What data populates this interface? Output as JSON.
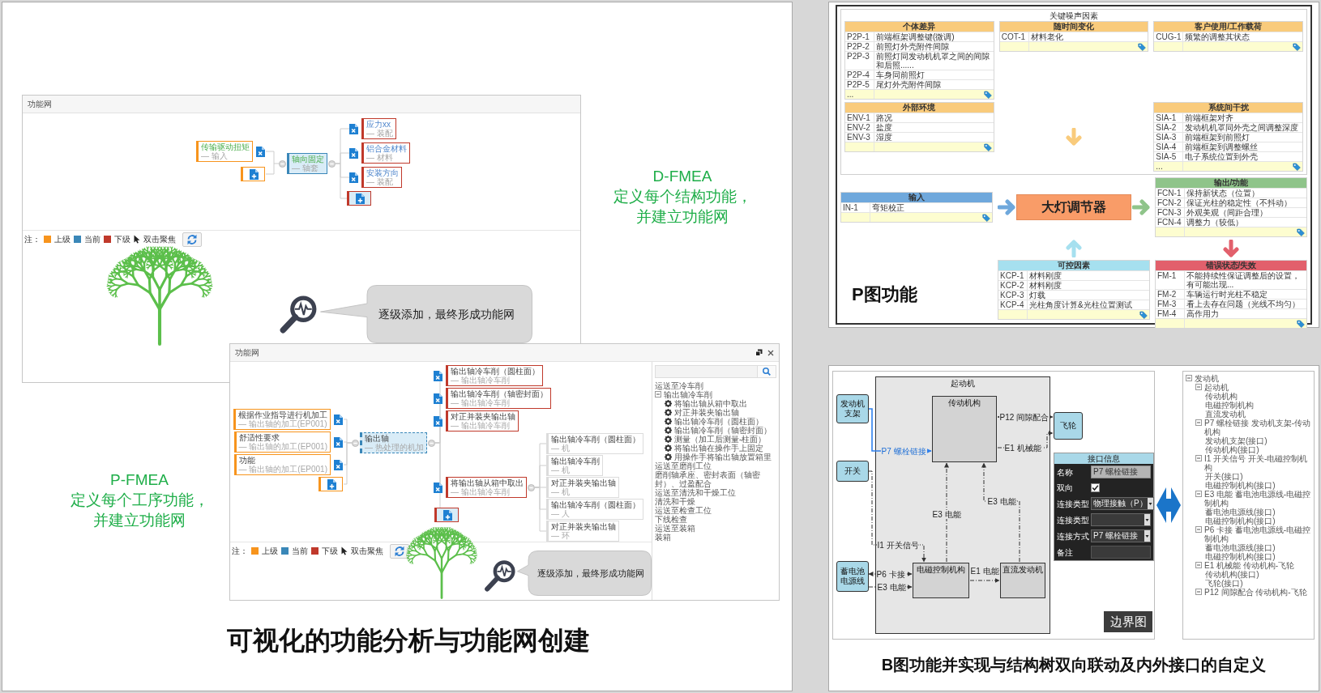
{
  "left_slide": {
    "net_top": {
      "title": "功能网",
      "upstream": [
        {
          "label": "传输驱动扭矩",
          "note": "— 输入"
        }
      ],
      "current": {
        "label": "轴向固定",
        "note": "— 轴套",
        "selected": false
      },
      "downstream": [
        {
          "label": "应力xx",
          "note": "— 装配"
        },
        {
          "label": "铝合金材料",
          "note": "— 材料"
        },
        {
          "label": "安装方向",
          "note": "— 装配"
        }
      ],
      "legend": {
        "prefix": "注：",
        "items": [
          {
            "label": "上级",
            "color": "#f7941d"
          },
          {
            "label": "当前",
            "color": "#3a87b8"
          },
          {
            "label": "下级",
            "color": "#c0392b"
          }
        ],
        "hint": "双击聚焦"
      },
      "callout": "逐级添加，最终形成功能网"
    },
    "d_fmea": {
      "heading": "D-FMEA",
      "description": "定义每个结构功能，并建立功能网"
    },
    "net_bottom": {
      "title": "功能网",
      "upstream": [
        {
          "label": "根据作业指导进行机加工",
          "note": "— 输出轴的加工(EP001)"
        },
        {
          "label": "舒适性要求",
          "note": "— 输出轴的加工(EP001)"
        },
        {
          "label": "功能",
          "note": "— 输出轴的加工(EP001)"
        }
      ],
      "current": {
        "label": "输出轴",
        "note": "— 热处理的机加",
        "selected": true
      },
      "downstream": [
        {
          "label": "输出轴冷车削（圆柱面）",
          "note": "— 输出轴冷车削"
        },
        {
          "label": "输出轴冷车削（轴密封面）",
          "note": "— 输出轴冷车削"
        },
        {
          "label": "对正并装夹输出轴",
          "note": "— 输出轴冷车削"
        },
        {
          "label": "将输出轴从箱中取出",
          "note": "— 输出轴冷车削",
          "children": [
            {
              "label": "输出轴冷车削（圆柱面）",
              "note": "— 机"
            },
            {
              "label": "输出轴冷车削",
              "note": "— 机"
            },
            {
              "label": "对正并装夹输出轴",
              "note": "— 机"
            },
            {
              "label": "输出轴冷车削（圆柱面）",
              "note": "— 人"
            },
            {
              "label": "对正并装夹输出轴",
              "note": "— 环"
            }
          ]
        }
      ],
      "legend": {
        "prefix": "注：",
        "items": [
          {
            "label": "上级",
            "color": "#f7941d"
          },
          {
            "label": "当前",
            "color": "#3a87b8"
          },
          {
            "label": "下级",
            "color": "#c0392b"
          }
        ],
        "hint": "双击聚焦"
      },
      "tree": [
        {
          "label": "运送至冷车削"
        },
        {
          "label": "输出轴冷车削",
          "expanded": true,
          "children": [
            {
              "label": "将输出轴从箱中取出"
            },
            {
              "label": "对正并装夹输出轴"
            },
            {
              "label": "输出轴冷车削（圆柱面）"
            },
            {
              "label": "输出轴冷车削（轴密封面）"
            },
            {
              "label": "测量（加工后测量-柱面）"
            },
            {
              "label": "将输出轴在操作手上固定"
            },
            {
              "label": "用操作手将输出轴放置箱里"
            }
          ]
        },
        {
          "label": "运送至磨削工位"
        },
        {
          "label": "磨削轴承座、密封表面（轴密封）、过盈配合"
        },
        {
          "label": "运送至清洗和干燥工位"
        },
        {
          "label": "清洗和干燥"
        },
        {
          "label": "运送至检查工位"
        },
        {
          "label": "下线检查"
        },
        {
          "label": "运送至装箱"
        },
        {
          "label": "装箱"
        }
      ],
      "callout": "逐级添加，最终形成功能网"
    },
    "p_fmea": {
      "heading": "P-FMEA",
      "description": "定义每个工序功能，并建立功能网"
    },
    "title": "可视化的功能分析与功能网创建"
  },
  "p_diagram": {
    "noise_title": "关键噪声因素",
    "noise_groups": [
      {
        "title": "个体差异",
        "color": "#f9cb7c",
        "rows": [
          {
            "id": "P2P-1",
            "text": "前端框架调整键(微调)"
          },
          {
            "id": "P2P-2",
            "text": "前照灯外壳附件间隙"
          },
          {
            "id": "P2P-3",
            "text": "前照灯同发动机机罩之间的间隙和后照......"
          },
          {
            "id": "P2P-4",
            "text": "车身同前照灯"
          },
          {
            "id": "P2P-5",
            "text": "尾灯外壳附件间隙"
          }
        ],
        "more": "..."
      },
      {
        "title": "随时间变化",
        "color": "#f9cb7c",
        "rows": [
          {
            "id": "COT-1",
            "text": "材料老化"
          }
        ]
      },
      {
        "title": "客户使用/工作载荷",
        "color": "#f9cb7c",
        "rows": [
          {
            "id": "CUG-1",
            "text": "频繁的调整其状态"
          }
        ]
      },
      {
        "title": "外部环境",
        "color": "#f9cb7c",
        "rows": [
          {
            "id": "ENV-1",
            "text": "路况"
          },
          {
            "id": "ENV-2",
            "text": "盐度"
          },
          {
            "id": "ENV-3",
            "text": "湿度"
          }
        ]
      },
      {
        "title": "系统间干扰",
        "color": "#f9cb7c",
        "rows": [
          {
            "id": "SIA-1",
            "text": "前端框架对齐"
          },
          {
            "id": "SIA-2",
            "text": "发动机机罩同外壳之间调整深度"
          },
          {
            "id": "SIA-3",
            "text": "前端框架到前照灯"
          },
          {
            "id": "SIA-4",
            "text": "前端框架到调整螺丝"
          },
          {
            "id": "SIA-5",
            "text": "电子系统位置到外壳"
          }
        ],
        "more": "..."
      }
    ],
    "system": "大灯调节器",
    "input": {
      "title": "输入",
      "color": "#6fa8dc",
      "rows": [
        {
          "id": "IN-1",
          "text": "弯矩校正"
        }
      ]
    },
    "output": {
      "title": "输出/功能",
      "color": "#8fc48a",
      "rows": [
        {
          "id": "FCN-1",
          "text": "保持新状态（位置）"
        },
        {
          "id": "FCN-2",
          "text": "保证光柱的稳定性（不抖动）"
        },
        {
          "id": "FCN-3",
          "text": "外观美观（间距合理）"
        },
        {
          "id": "FCN-4",
          "text": "调整力（较低）"
        }
      ]
    },
    "control": {
      "title": "可控因素",
      "color": "#a6e0ef",
      "rows": [
        {
          "id": "KCP-1",
          "text": "材料刚度"
        },
        {
          "id": "KCP-2",
          "text": "材料刚度"
        },
        {
          "id": "KCP-3",
          "text": "灯载"
        },
        {
          "id": "KCP-4",
          "text": "光柱角度计算&光柱位置测试"
        }
      ]
    },
    "failure": {
      "title": "错误状态/失效",
      "color": "#e2606c",
      "rows": [
        {
          "id": "FM-1",
          "text": "不能持续性保证调整后的设置，有可能出现..."
        },
        {
          "id": "FM-2",
          "text": "车辆运行时光柱不稳定"
        },
        {
          "id": "FM-3",
          "text": "看上去存在问题（光线不均匀）"
        },
        {
          "id": "FM-4",
          "text": "高作用力"
        }
      ]
    },
    "label": "P图功能"
  },
  "b_diagram_slide": {
    "diagram": {
      "external": [
        {
          "label": "发动机支架"
        },
        {
          "label": "开关"
        },
        {
          "label": "蓄电池电源线"
        }
      ],
      "system": {
        "title": "起动机",
        "parts": [
          "传动机构",
          "电磁控制机构",
          "直流发动机"
        ]
      },
      "flywheel": "飞轮",
      "connections": [
        {
          "label": "P7 螺栓链接",
          "selected": true
        },
        {
          "label": "P12 间隙配合",
          "selected": false
        },
        {
          "label": "E1 机械能",
          "selected": false
        },
        {
          "label": "I1 开关信号",
          "selected": false
        },
        {
          "label": "P6 卡接",
          "selected": false
        },
        {
          "label": "E3 电能",
          "selected": false
        },
        {
          "label": "E3 电能",
          "selected": false
        },
        {
          "label": "E3 电能",
          "selected": false
        },
        {
          "label": "E1 电能",
          "selected": false
        }
      ],
      "interface": {
        "title": "接口信息",
        "fields": [
          {
            "kind": "text",
            "label": "名称",
            "value": "P7 螺栓链接"
          },
          {
            "kind": "checkbox",
            "label": "双向",
            "checked": true
          },
          {
            "kind": "select",
            "label": "连接类型",
            "value": "物理接触（P）"
          },
          {
            "kind": "select",
            "label": "连接类型"
          },
          {
            "kind": "select",
            "label": "连接方式",
            "value": "P7 螺栓链接"
          },
          {
            "kind": "text",
            "label": "备注"
          }
        ]
      },
      "tag": "边界图"
    },
    "structure_tree": [
      {
        "label": "发动机",
        "expanded": true,
        "children": [
          {
            "label": "起动机",
            "expanded": true,
            "children": [
              {
                "label": "传动机构"
              },
              {
                "label": "电磁控制机构"
              },
              {
                "label": "直流发动机"
              }
            ]
          },
          {
            "label": "P7 螺栓链接 发动机支架-传动机构",
            "expanded": true,
            "children": [
              {
                "label": "发动机支架(接口)"
              },
              {
                "label": "传动机构(接口)"
              }
            ]
          },
          {
            "label": "I1 开关信号 开关-电磁控制机构",
            "expanded": true,
            "children": [
              {
                "label": "开关(接口)"
              },
              {
                "label": "电磁控制机构(接口)"
              }
            ]
          },
          {
            "label": "E3 电能 蓄电池电源线-电磁控制机构",
            "expanded": true,
            "children": [
              {
                "label": "蓄电池电源线(接口)"
              },
              {
                "label": "电磁控制机构(接口)"
              }
            ]
          },
          {
            "label": "P6 卡接 蓄电池电源线-电磁控制机构",
            "expanded": true,
            "children": [
              {
                "label": "蓄电池电源线(接口)"
              },
              {
                "label": "电磁控制机构(接口)"
              }
            ]
          },
          {
            "label": "E1 机械能 传动机构-飞轮",
            "expanded": true,
            "children": [
              {
                "label": "传动机构(接口)"
              },
              {
                "label": "飞轮(接口)"
              }
            ]
          },
          {
            "label": "P12 间隙配合 传动机构-飞轮",
            "expanded": true
          }
        ]
      }
    ],
    "caption": "B图功能并实现与结构树双向联动及内外接口的自定义"
  }
}
